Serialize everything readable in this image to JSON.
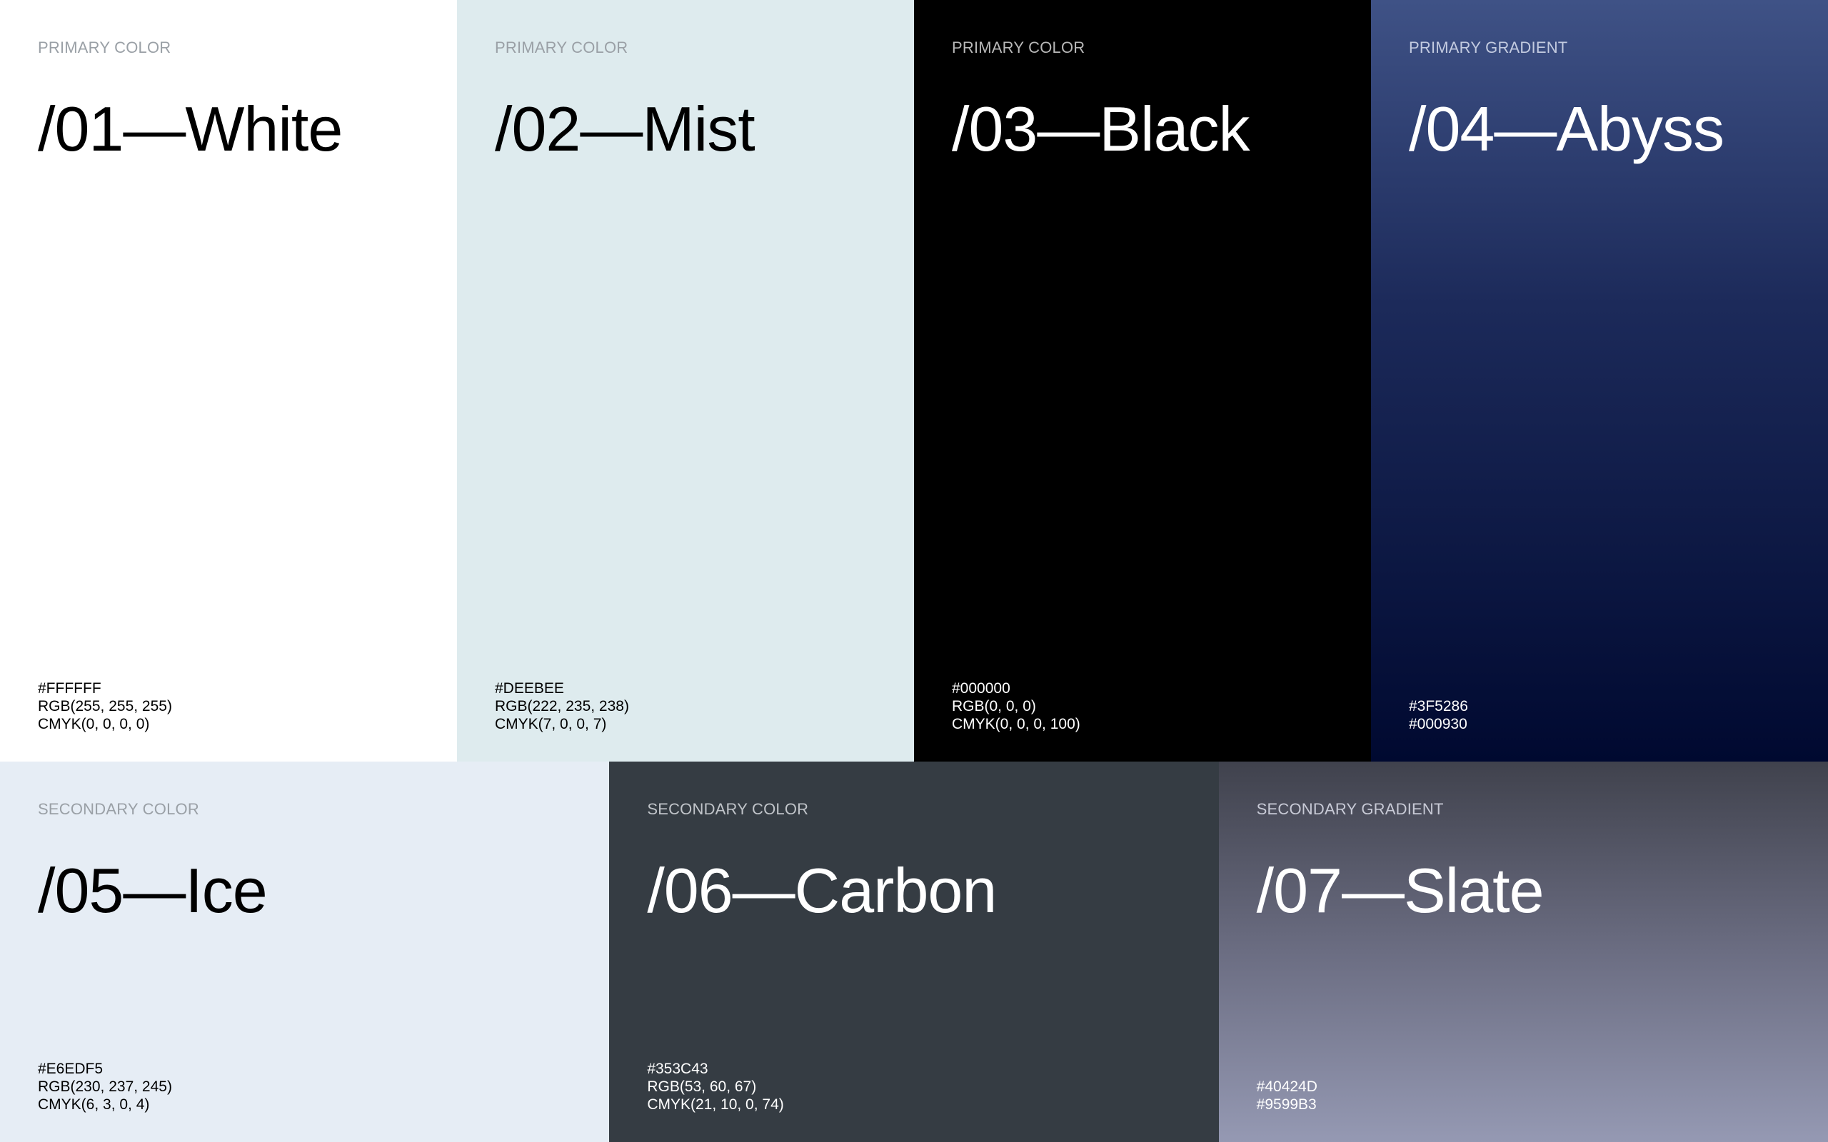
{
  "swatches": [
    {
      "kind": "PRIMARY COLOR",
      "name": "/01—White",
      "hex": "#FFFFFF",
      "rgb": "RGB(255, 255, 255)",
      "cmyk": "CMYK(0, 0, 0, 0)",
      "color": "#FFFFFF"
    },
    {
      "kind": "PRIMARY COLOR",
      "name": "/02—Mist",
      "hex": "#DEEBEE",
      "rgb": "RGB(222, 235, 238)",
      "cmyk": "CMYK(7, 0, 0, 7)",
      "color": "#DEEBEE"
    },
    {
      "kind": "PRIMARY COLOR",
      "name": "/03—Black",
      "hex": "#000000",
      "rgb": "RGB(0, 0, 0)",
      "cmyk": "CMYK(0, 0, 0, 100)",
      "color": "#000000"
    },
    {
      "kind": "PRIMARY GRADIENT",
      "name": "/04—Abyss",
      "stop1": "#3F5286",
      "stop2": "#000930"
    },
    {
      "kind": "SECONDARY COLOR",
      "name": "/05—Ice",
      "hex": "#E6EDF5",
      "rgb": "RGB(230, 237, 245)",
      "cmyk": "CMYK(6, 3, 0, 4)",
      "color": "#E6EDF5"
    },
    {
      "kind": "SECONDARY COLOR",
      "name": "/06—Carbon",
      "hex": "#353C43",
      "rgb": "RGB(53, 60, 67)",
      "cmyk": "CMYK(21, 10, 0, 74)",
      "color": "#353C43"
    },
    {
      "kind": "SECONDARY GRADIENT",
      "name": "/07—Slate",
      "stop1": "#40424D",
      "stop2": "#9599B3"
    }
  ]
}
